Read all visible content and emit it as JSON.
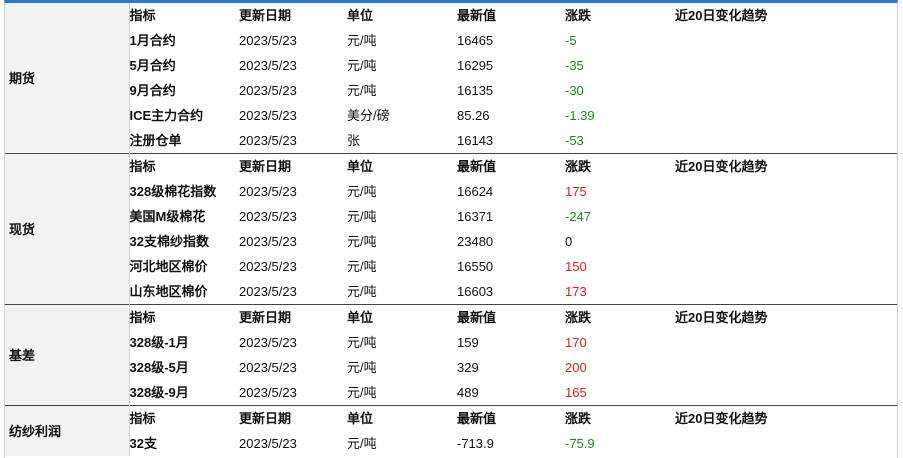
{
  "header": [
    "指标",
    "更新日期",
    "单位",
    "最新值",
    "涨跌",
    "近20日变化趋势"
  ],
  "sections": [
    {
      "category": "期货",
      "show_header": false,
      "rows": [
        {
          "name": "1月合约",
          "date": "2023/5/23",
          "unit": "元/吨",
          "value": "16465",
          "change": "-5",
          "dir": "down"
        },
        {
          "name": "5月合约",
          "date": "2023/5/23",
          "unit": "元/吨",
          "value": "16295",
          "change": "-35",
          "dir": "down"
        },
        {
          "name": "9月合约",
          "date": "2023/5/23",
          "unit": "元/吨",
          "value": "16135",
          "change": "-30",
          "dir": "down"
        },
        {
          "name": "ICE主力合约",
          "date": "2023/5/23",
          "unit": "美分/磅",
          "value": "85.26",
          "change": "-1.39",
          "dir": "down"
        },
        {
          "name": "注册仓单",
          "date": "2023/5/23",
          "unit": "张",
          "value": "16143",
          "change": "-53",
          "dir": "down"
        }
      ]
    },
    {
      "category": "现货",
      "show_header": true,
      "rows": [
        {
          "name": "328级棉花指数",
          "date": "2023/5/23",
          "unit": "元/吨",
          "value": "16624",
          "change": "175",
          "dir": "up"
        },
        {
          "name": "美国M级棉花",
          "date": "2023/5/23",
          "unit": "元/吨",
          "value": "16371",
          "change": "-247",
          "dir": "down"
        },
        {
          "name": "32支棉纱指数",
          "date": "2023/5/23",
          "unit": "元/吨",
          "value": "23480",
          "change": "0",
          "dir": "flat"
        },
        {
          "name": "河北地区棉价",
          "date": "2023/5/23",
          "unit": "元/吨",
          "value": "16550",
          "change": "150",
          "dir": "up"
        },
        {
          "name": "山东地区棉价",
          "date": "2023/5/23",
          "unit": "元/吨",
          "value": "16603",
          "change": "173",
          "dir": "up"
        }
      ]
    },
    {
      "category": "基差",
      "show_header": true,
      "rows": [
        {
          "name": "328级-1月",
          "date": "2023/5/23",
          "unit": "元/吨",
          "value": "159",
          "change": "170",
          "dir": "up"
        },
        {
          "name": "328级-5月",
          "date": "2023/5/23",
          "unit": "元/吨",
          "value": "329",
          "change": "200",
          "dir": "up"
        },
        {
          "name": "328级-9月",
          "date": "2023/5/23",
          "unit": "元/吨",
          "value": "489",
          "change": "165",
          "dir": "up"
        }
      ]
    },
    {
      "category": "纺纱利润",
      "show_header": true,
      "rows": [
        {
          "name": "32支",
          "date": "2023/5/23",
          "unit": "元/吨",
          "value": "-713.9",
          "change": "-75.9",
          "dir": "down"
        }
      ]
    }
  ],
  "colors": {
    "up": "#d21f1f",
    "down": "#1d8a1d",
    "accent": "#2a79c8"
  }
}
